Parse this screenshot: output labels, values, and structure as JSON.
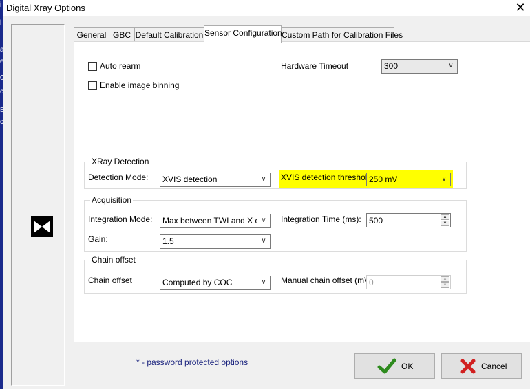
{
  "window": {
    "title": "Digital Xray Options",
    "close_glyph": "✕"
  },
  "background_strip": [
    "i",
    "l",
    "a",
    "e",
    "0",
    "c",
    "E",
    "c"
  ],
  "tabs": [
    {
      "label": "General",
      "active": false
    },
    {
      "label": "GBC",
      "active": false
    },
    {
      "label": "Default Calibration",
      "active": false
    },
    {
      "label": "Sensor Configuration",
      "active": true
    },
    {
      "label": "Custom Path for Calibration Files",
      "active": false
    }
  ],
  "top_options": {
    "auto_rearm_label": "Auto rearm",
    "auto_rearm_checked": false,
    "image_binning_label": "Enable image binning",
    "image_binning_checked": false,
    "hardware_timeout_label": "Hardware Timeout",
    "hardware_timeout_value": "300"
  },
  "xray_detection": {
    "legend": "XRay Detection",
    "mode_label": "Detection Mode:",
    "mode_value": "XVIS detection",
    "threshold_label": "XVIS detection threshold:",
    "threshold_value": "250 mV",
    "highlight_color": "#ffff00"
  },
  "acquisition": {
    "legend": "Acquisition",
    "integration_mode_label": "Integration Mode:",
    "integration_mode_value": "Max between TWI and X detc",
    "integration_time_label": "Integration Time (ms):",
    "integration_time_value": "500",
    "gain_label": "Gain:",
    "gain_value": "1.5"
  },
  "chain_offset": {
    "legend": "Chain  offset",
    "label": "Chain offset",
    "value": "Computed by COC",
    "manual_label": "Manual chain offset (mV):",
    "manual_value": "0"
  },
  "footer": {
    "note": "* - password protected options",
    "ok_label": "OK",
    "cancel_label": "Cancel"
  }
}
